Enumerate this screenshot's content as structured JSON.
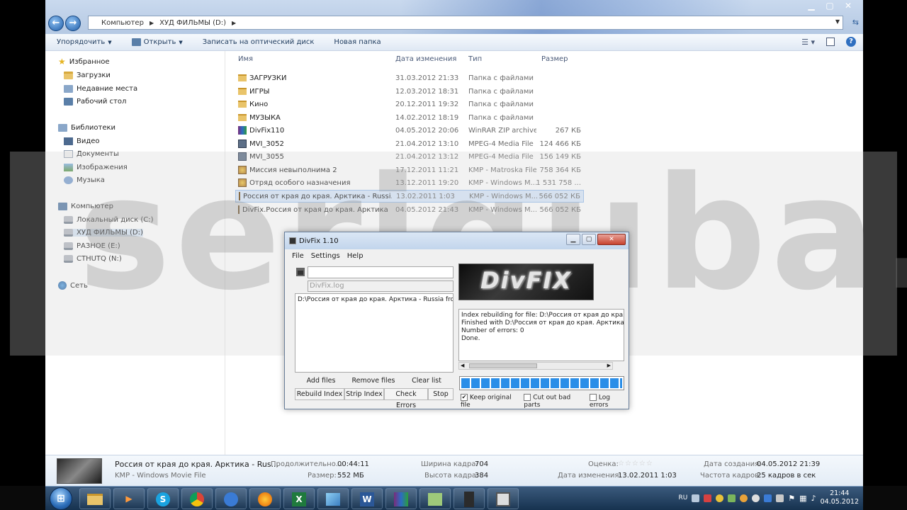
{
  "explorer": {
    "breadcrumb": [
      "Компьютер",
      "ХУД ФИЛЬМЫ (D:)"
    ],
    "toolbar": {
      "organize": "Упорядочить",
      "open": "Открыть",
      "burn": "Записать на оптический диск",
      "new_folder": "Новая папка"
    },
    "nav": {
      "favorites": "Избранное",
      "downloads": "Загрузки",
      "recent": "Недавние места",
      "desktop": "Рабочий стол",
      "libraries": "Библиотеки",
      "video": "Видео",
      "documents": "Документы",
      "images": "Изображения",
      "music": "Музыка",
      "computer": "Компьютер",
      "disk_c": "Локальный диск (C:)",
      "disk_d": "ХУД ФИЛЬМЫ (D:)",
      "disk_e": "РАЗНОЕ (E:)",
      "disk_n": "СТНUTQ (N:)",
      "network": "Сеть"
    },
    "columns": {
      "name": "Имя",
      "date": "Дата изменения",
      "type": "Тип",
      "size": "Размер"
    },
    "files": [
      {
        "name": "ЗАГРУЗКИ",
        "date": "31.03.2012 21:33",
        "type": "Папка с файлами",
        "size": "",
        "icon": "folder-icon"
      },
      {
        "name": "ИГРЫ",
        "date": "12.03.2012 18:31",
        "type": "Папка с файлами",
        "size": "",
        "icon": "folder-icon"
      },
      {
        "name": "Кино",
        "date": "20.12.2011 19:32",
        "type": "Папка с файлами",
        "size": "",
        "icon": "folder-icon"
      },
      {
        "name": "МУЗЫКА",
        "date": "14.02.2012 18:19",
        "type": "Папка с файлами",
        "size": "",
        "icon": "folder-icon"
      },
      {
        "name": "DivFix110",
        "date": "04.05.2012 20:06",
        "type": "WinRAR ZIP archive",
        "size": "267 КБ",
        "icon": "rar-icon"
      },
      {
        "name": "MVI_3052",
        "date": "21.04.2012 13:10",
        "type": "MPEG-4 Media File",
        "size": "124 466 КБ",
        "icon": "mp4-icon"
      },
      {
        "name": "MVI_3055",
        "date": "21.04.2012 13:12",
        "type": "MPEG-4 Media File",
        "size": "156 149 КБ",
        "icon": "mp4-icon"
      },
      {
        "name": "Миссия невыполнима 2",
        "date": "17.12.2011 11:21",
        "type": "KMP - Matroska File",
        "size": "758 364 КБ",
        "icon": "kmp-icon"
      },
      {
        "name": "Отряд особого назначения",
        "date": "13.12.2011 19:20",
        "type": "KMP - Windows M...",
        "size": "1 531 758 ...",
        "icon": "kmp-icon"
      },
      {
        "name": "Россия от края до края. Арктика - Russi...",
        "date": "13.02.2011 1:03",
        "type": "KMP - Windows M...",
        "size": "566 052 КБ",
        "icon": "kmp-icon"
      },
      {
        "name": "DivFix.Россия от края до края. Арктика ...",
        "date": "04.05.2012 21:43",
        "type": "KMP - Windows M...",
        "size": "566 052 КБ",
        "icon": "kmp-icon"
      }
    ],
    "details": {
      "title": "Россия от края до края. Арктика - Rus...",
      "subtitle": "KMP - Windows Movie File",
      "duration_label": "Продолжительно...",
      "duration": "00:44:11",
      "size_label": "Размер:",
      "size": "552 МБ",
      "width_label": "Ширина кадра:",
      "width": "704",
      "height_label": "Высота кадра:",
      "height": "384",
      "rating_label": "Оценка:",
      "stars": "☆☆☆☆☆",
      "modified_label": "Дата изменения:",
      "modified": "13.02.2011 1:03",
      "created_label": "Дата создания:",
      "created": "04.05.2012 21:39",
      "fps_label": "Частота кадров:",
      "fps": "25 кадров в сек"
    }
  },
  "watermark": "serjguba.ru",
  "divfix": {
    "title": "DivFix 1.10",
    "menu": [
      "File",
      "Settings",
      "Help"
    ],
    "output_path": "",
    "log_field": "DivFix.log",
    "file_entry": "D:\\Россия от края до края. Арктика - Russia from ei",
    "buttons": {
      "add": "Add files",
      "remove": "Remove files",
      "clear": "Clear list",
      "rebuild": "Rebuild Index",
      "strip": "Strip Index",
      "check": "Check Errors",
      "stop": "Stop"
    },
    "logo_text": "DivFIX",
    "log_lines": [
      "Index rebuilding for file: D:\\Россия от края до края. А",
      "Finished with D:\\Россия от края до края. Арктика -",
      "Number of errors: 0",
      "Done."
    ],
    "progress": 1.0,
    "options": {
      "keep": "Keep original file",
      "keep_checked": true,
      "cut": "Cut out bad parts",
      "cut_checked": false,
      "log": "Log errors",
      "log_checked": false
    }
  },
  "taskbar": {
    "lang": "RU",
    "time": "21:44",
    "date": "04.05.2012"
  }
}
